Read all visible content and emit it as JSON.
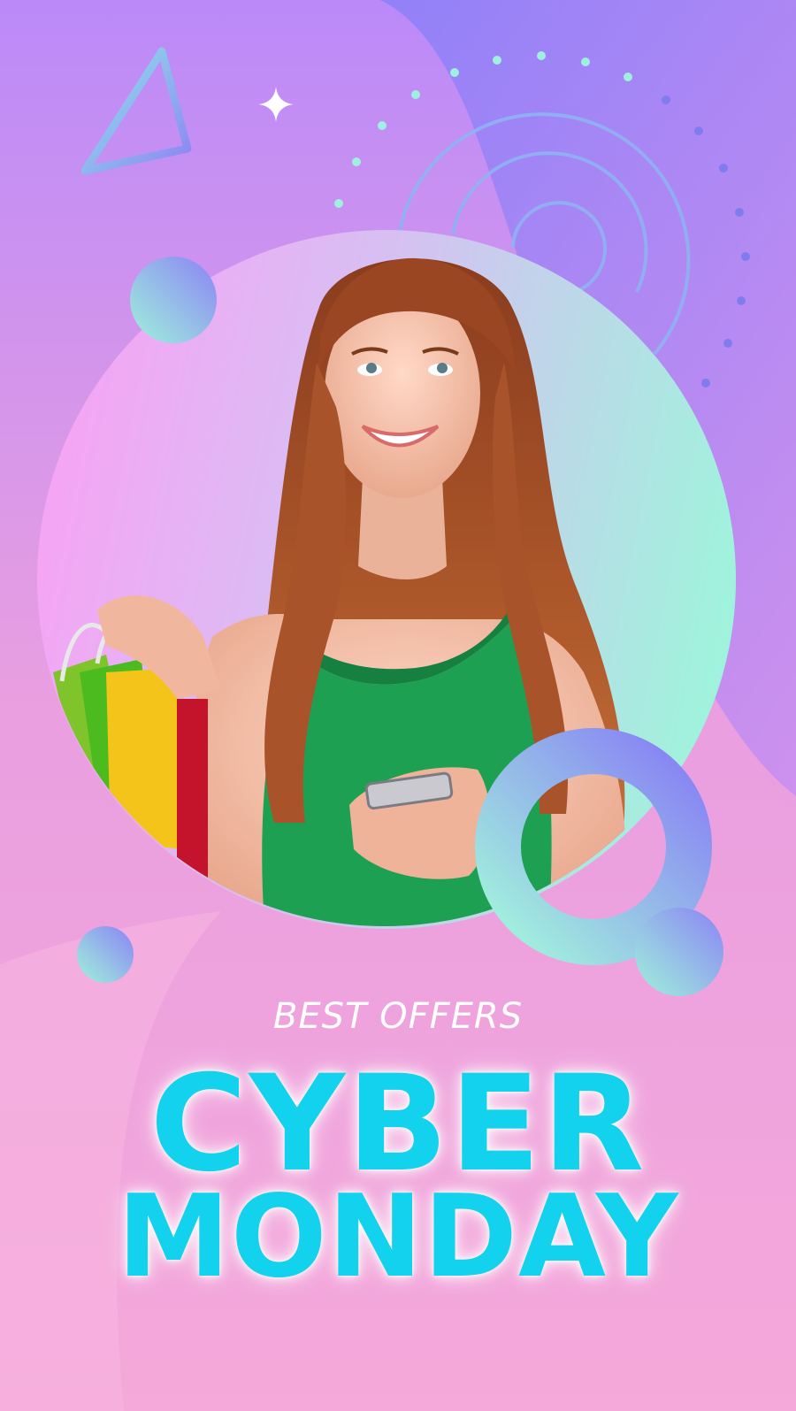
{
  "poster": {
    "subtitle": "BEST OFFERS",
    "headline_line1": "CYBER",
    "headline_line2": "MONDAY"
  },
  "colors": {
    "background_top": "#bb8af8",
    "background_bottom": "#f5a7d8",
    "headline": "#12d2ee",
    "mint": "#9cf5dd",
    "periwinkle": "#8a82f4"
  },
  "images": {
    "photo": "woman-with-shopping-bags-photo"
  }
}
